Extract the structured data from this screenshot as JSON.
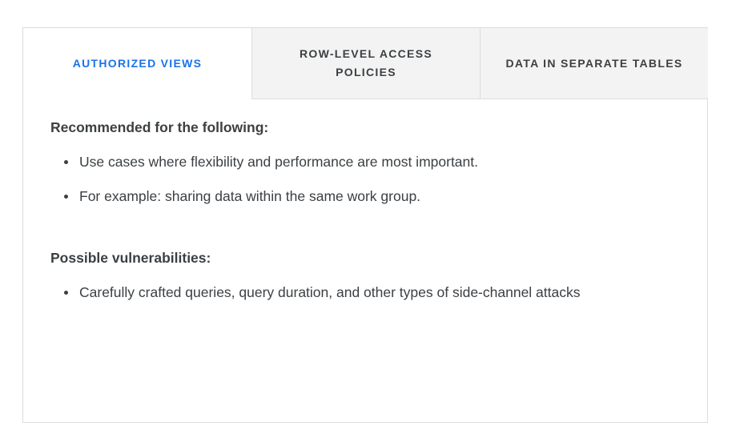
{
  "tabs": [
    {
      "label": "AUTHORIZED VIEWS",
      "active": true
    },
    {
      "label": "ROW-LEVEL ACCESS POLICIES",
      "active": false
    },
    {
      "label": "DATA IN SEPARATE TABLES",
      "active": false
    }
  ],
  "panel": {
    "recommended": {
      "heading": "Recommended for the following:",
      "items": [
        "Use cases where flexibility and performance are most important.",
        "For example: sharing data within the same work group."
      ]
    },
    "vulnerabilities": {
      "heading": "Possible vulnerabilities:",
      "items": [
        "Carefully crafted queries, query duration, and other types of side-channel attacks"
      ]
    }
  },
  "colors": {
    "active_tab_text": "#1a73e8",
    "inactive_tab_bg": "#f3f3f3",
    "border": "#dadce0"
  }
}
